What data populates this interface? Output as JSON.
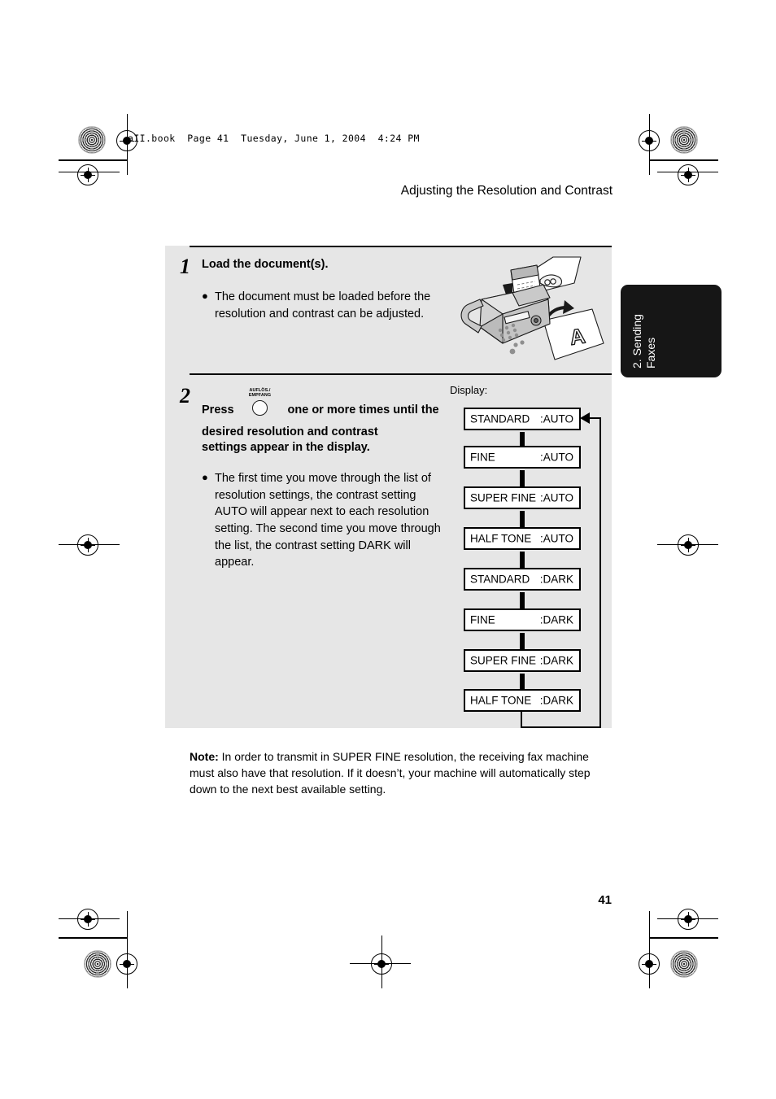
{
  "page": {
    "file_header": "aII.book  Page 41  Tuesday, June 1, 2004  4:24 PM",
    "running_head": "Adjusting the Resolution and Contrast",
    "folio": "41"
  },
  "side_tab": {
    "line1": "2. Sending",
    "line2": "Faxes"
  },
  "steps": [
    {
      "number": "1",
      "heading": "Load the document(s).",
      "bullet_marker": "●",
      "bullets": [
        "The document must be loaded before the resolution and contrast can be adjusted."
      ]
    },
    {
      "number": "2",
      "press_word": "Press",
      "key_label_line1": "AUFLÖS./",
      "key_label_line2": "EMPFANG",
      "heading_tail": "one or more times until the",
      "heading_line2": "desired resolution and contrast",
      "heading_line3": "settings appear in the display.",
      "bullet_marker": "●",
      "bullets": [
        "The first time you move through the list of resolution settings, the contrast setting AUTO will appear next to each resolution setting. The second time you move through the list, the contrast setting DARK will appear."
      ]
    }
  ],
  "display_flow": {
    "label": "Display:",
    "items": [
      {
        "mode": "STANDARD",
        "value": ":AUTO"
      },
      {
        "mode": "FINE",
        "value": ":AUTO"
      },
      {
        "mode": "SUPER FINE",
        "value": ":AUTO"
      },
      {
        "mode": "HALF TONE",
        "value": ":AUTO"
      },
      {
        "mode": "STANDARD",
        "value": ":DARK"
      },
      {
        "mode": "FINE",
        "value": ":DARK"
      },
      {
        "mode": "SUPER FINE",
        "value": ":DARK"
      },
      {
        "mode": "HALF TONE",
        "value": ":DARK"
      }
    ]
  },
  "note": {
    "label": "Note:",
    "text": " In order to transmit in SUPER FINE resolution, the receiving fax machine must also have that resolution. If it doesn’t, your machine will automatically step down to the next best available setting."
  },
  "illustration": {
    "name": "fax-machine-loading-document",
    "sheet_letter": "A"
  },
  "colors": {
    "panel_gray": "#e6e6e6",
    "tab_black": "#161616",
    "ink": "#000000"
  }
}
